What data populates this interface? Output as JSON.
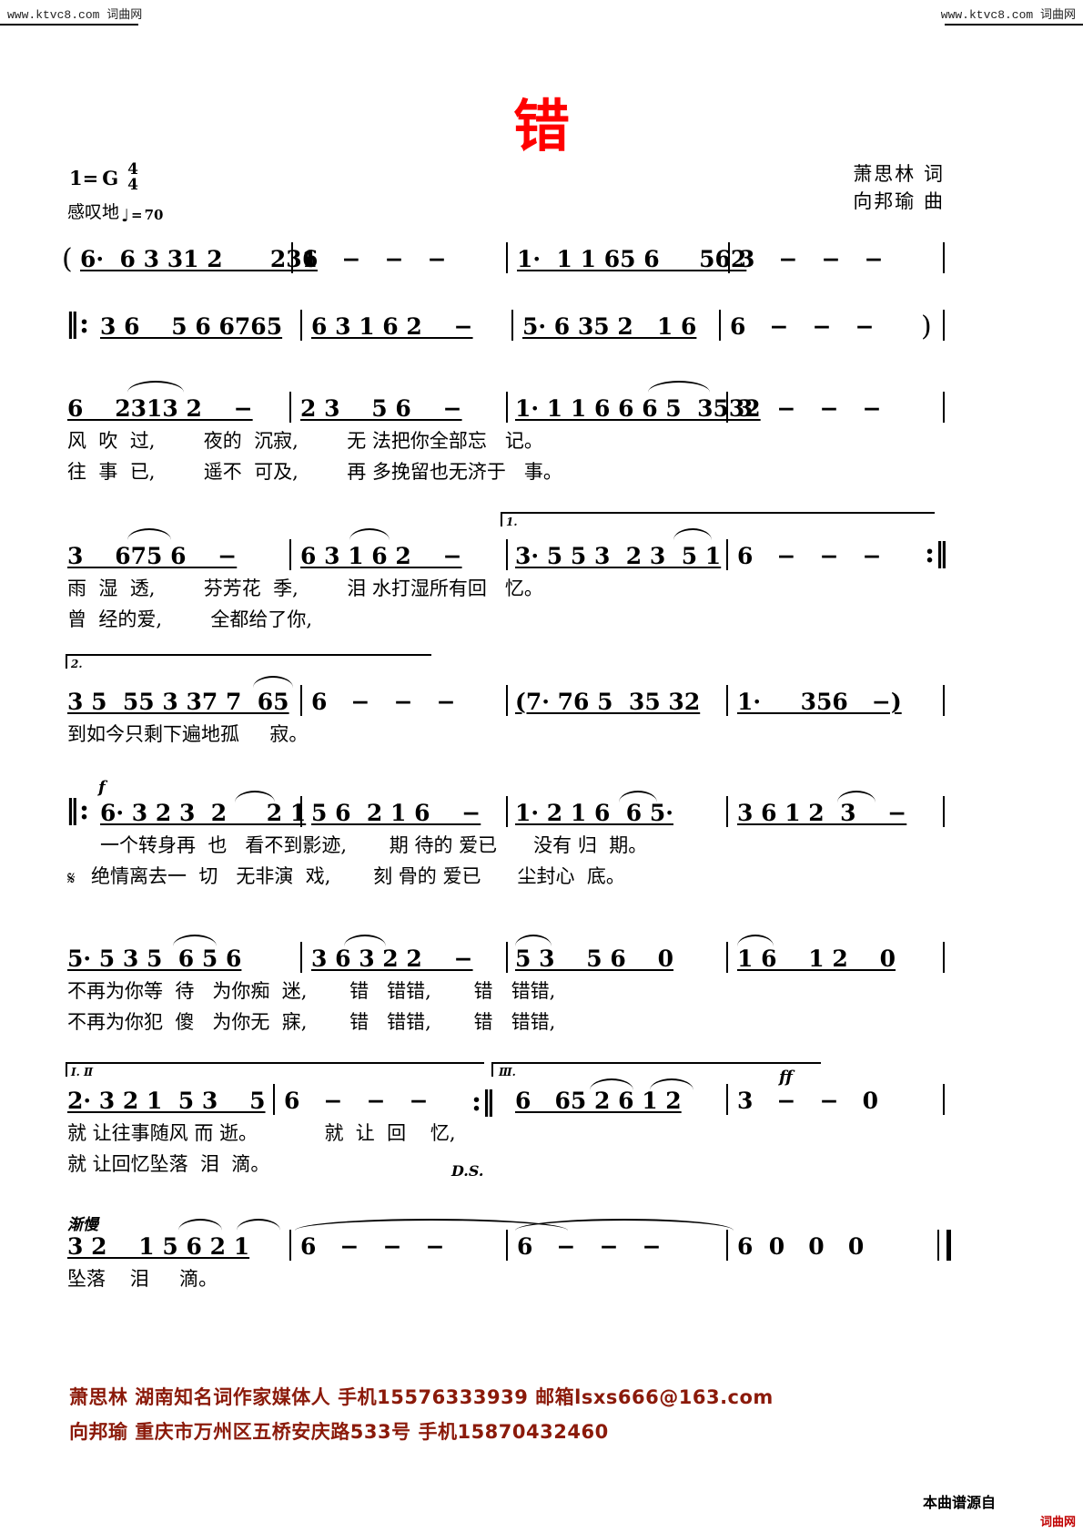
{
  "watermark": {
    "left_text": "www.ktvc8.com  词曲网",
    "right_text": "www.ktvc8.com  词曲网"
  },
  "header": {
    "title": "错",
    "title_color": "#ff0000",
    "lyricist_line": "萧思林  词",
    "composer_line": "向邦瑜  曲"
  },
  "score_meta": {
    "key_label": "1=",
    "key_value": "G",
    "time_num": "4",
    "time_den": "4",
    "expression": "感叹地",
    "tempo_note": "♩",
    "tempo_eq": "=",
    "tempo_bpm": "70"
  },
  "systems": [
    {
      "id": "prelude-a",
      "label": "intro-measure-1",
      "open_paren": "(",
      "measures": [
        {
          "notes": "6·  6 3 31 2      231"
        },
        {
          "notes": "6   −   −   −"
        },
        {
          "notes": "1·  1 1 65 6     562"
        },
        {
          "notes": "3   −   −   −"
        }
      ]
    },
    {
      "id": "prelude-b",
      "label": "intro-measure-2",
      "repeat_open": true,
      "measures": [
        {
          "notes": "3 6    5 6 6765"
        },
        {
          "notes": "6 3 1 6 2    −"
        },
        {
          "notes": "5· 6 35 2   1 6"
        },
        {
          "notes": "6   −   −   −"
        }
      ],
      "close_paren": ")"
    },
    {
      "id": "verse-line-1",
      "measures": [
        {
          "notes": "6    2313 2    −"
        },
        {
          "notes": "2 3    5 6    −"
        },
        {
          "notes": "1· 1 1 6 6 6 5  3532"
        },
        {
          "notes": "3   −   −   −"
        }
      ],
      "lyrics_v1": "风  吹  过,        夜的  沉寂,        无 法把你全部忘   记。",
      "lyrics_v2": "往  事  已,        遥不  可及,        再 多挽留也无济于   事。"
    },
    {
      "id": "verse-line-2",
      "ending": "1.",
      "measures": [
        {
          "notes": "3    675 6    −"
        },
        {
          "notes": "6 3 1 6 2    −"
        },
        {
          "notes": "3· 5 5 3  2 3  5 1"
        },
        {
          "notes": "6   −   −   −"
        }
      ],
      "lyrics_v1": "雨  湿  透,        芬芳花  季,        泪 水打湿所有回   忆。",
      "lyrics_v2": "曾  经的爱,        全都给了你,"
    },
    {
      "id": "verse-line-3",
      "ending": "2.",
      "measures": [
        {
          "notes": "3 5  55 3 37 7  65"
        },
        {
          "notes": "6   −   −   −"
        },
        {
          "notes": "(7· 76 5  35 32"
        },
        {
          "notes": "1·     356   −)"
        }
      ],
      "lyrics_v1": "到如今只剩下遍地孤     寂。"
    },
    {
      "id": "chorus-line-1",
      "repeat_open": true,
      "dynamic": "f",
      "measures": [
        {
          "notes": "6· 3 2 3  2     2 1"
        },
        {
          "notes": "5 6  2 1 6    −"
        },
        {
          "notes": "1· 2 1 6  6 5·"
        },
        {
          "notes": "3 6 1 2  3    −"
        }
      ],
      "lyrics_v1": "一个转身再  也   看不到影迹,       期 待的 爱已      没有 归  期。",
      "lyrics_v2": "绝情离去一  切   无非演  戏,       刻 骨的 爱已      尘封心  底。",
      "segno_on_v2": "𝄋"
    },
    {
      "id": "chorus-line-2",
      "measures": [
        {
          "notes": "5· 5 3 5  6 5 6"
        },
        {
          "notes": "3 6 3 2 2    −"
        },
        {
          "notes": "5 3    5 6    0"
        },
        {
          "notes": "1 6    1 2    0"
        }
      ],
      "lyrics_v1": "不再为你等  待   为你痴  迷,       错   错错,       错   错错,",
      "lyrics_v2": "不再为你犯  傻   为你无  寐,       错   错错,       错   错错,"
    },
    {
      "id": "chorus-line-3",
      "ending_a": "Ⅰ. Ⅱ",
      "ending_b": "Ⅲ.",
      "dynamic": "ff",
      "measures": [
        {
          "notes": "2· 3 2 1  5 3    5"
        },
        {
          "notes": "6   −   −   −"
        },
        {
          "notes": "6   65 2 6 1 2"
        },
        {
          "notes": "3   −   −   0"
        }
      ],
      "lyrics_v1": "就 让往事随风 而 逝。           就  让  回    忆,",
      "lyrics_v2": "就 让回忆坠落  泪  滴。",
      "ds_mark": "D.S."
    },
    {
      "id": "coda-line",
      "tempo_text": "渐慢",
      "measures": [
        {
          "notes": "3 2    1 5 6 2 1"
        },
        {
          "notes": "6   −   −   −"
        },
        {
          "notes": "6   −   −   −"
        },
        {
          "notes": "6  0   0   0"
        }
      ],
      "lyrics_v1": "坠落    泪     滴。"
    }
  ],
  "footer": {
    "line1": "萧思林  湖南知名词作家媒体人  手机15576333939  邮箱lsxs666@163.com",
    "line2": "向邦瑜  重庆市万州区五桥安庆路533号  手机15870432460",
    "source_note": "本曲谱源自",
    "site_badge": "词曲网",
    "color": "#8b1a0a"
  }
}
